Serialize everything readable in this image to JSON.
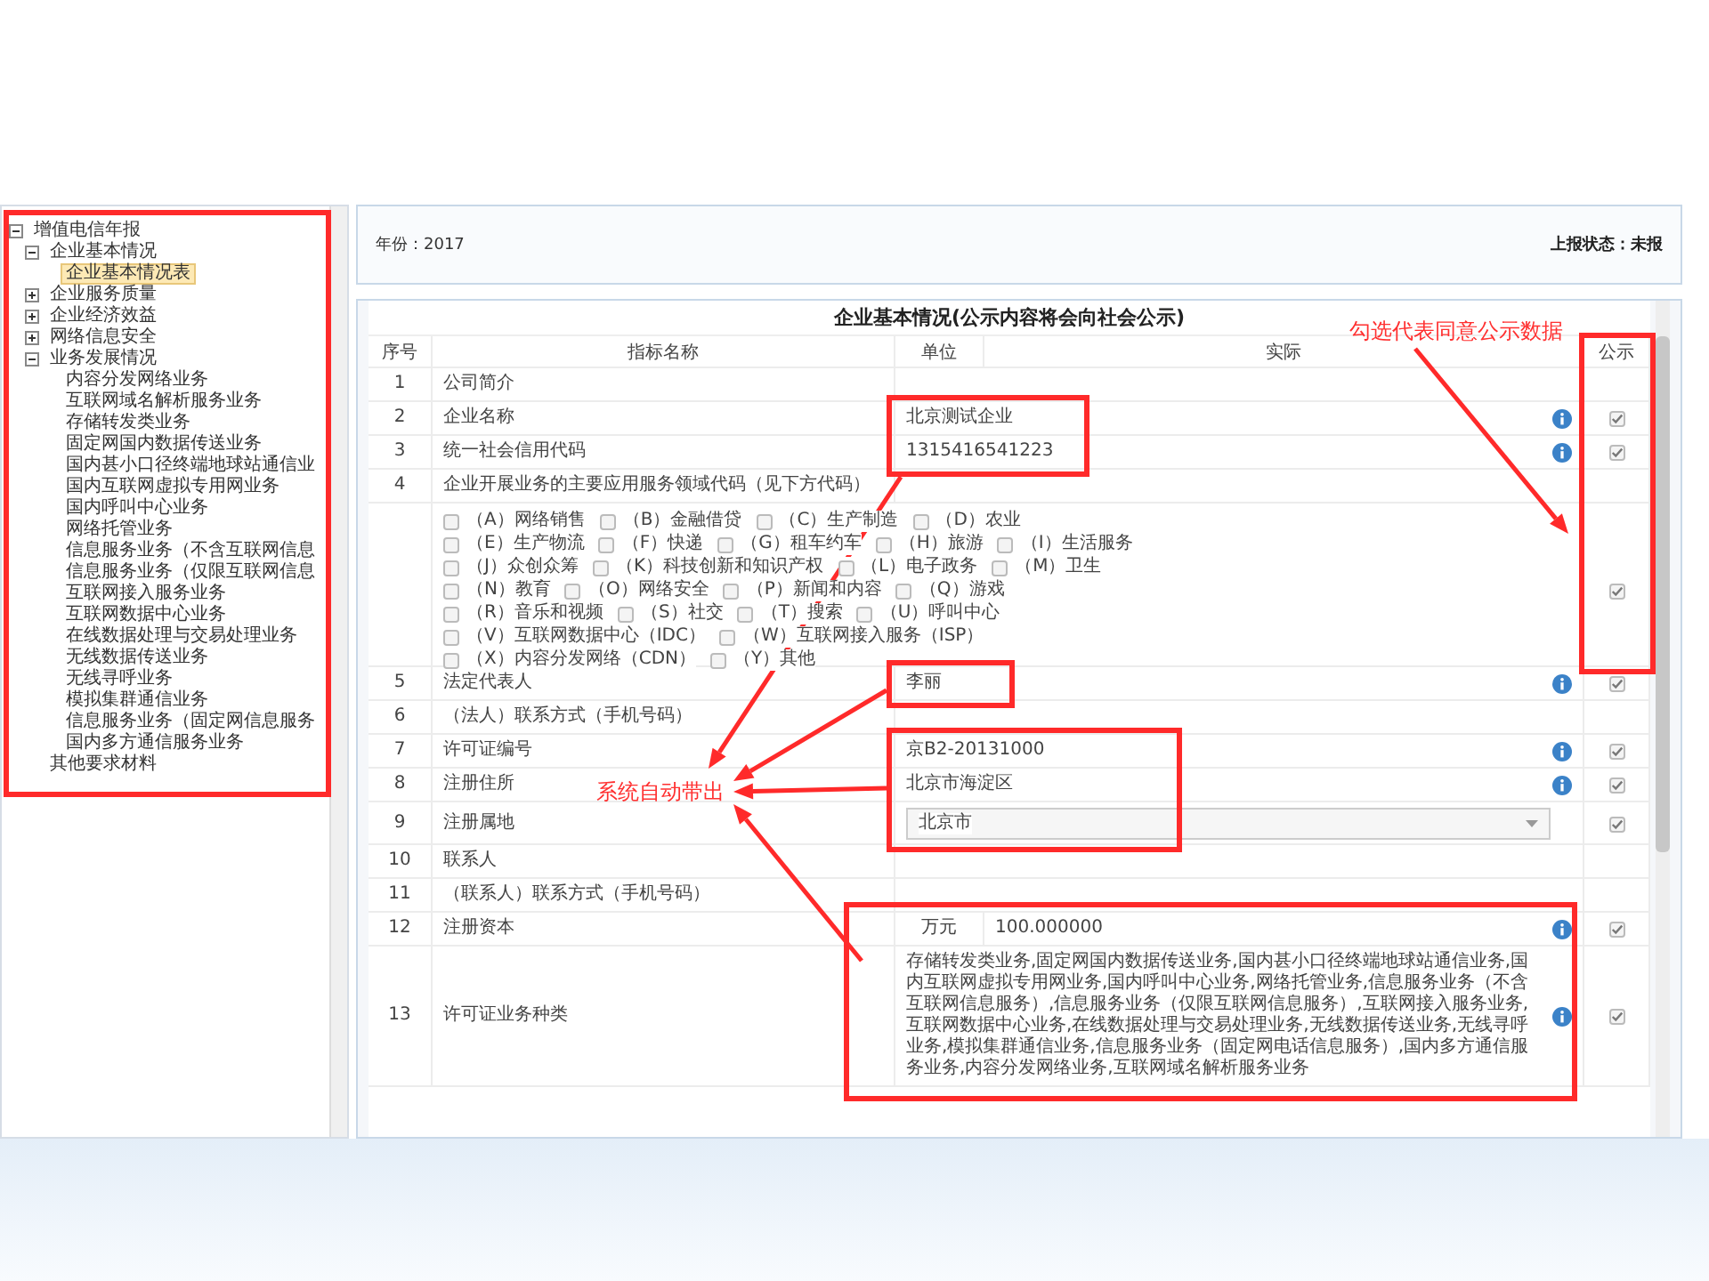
{
  "tree": [
    {
      "label": "增值电信年报",
      "expanded": true,
      "selected": false,
      "children": [
        {
          "label": "企业基本情况",
          "expanded": true,
          "selected": false,
          "children": [
            {
              "label": "企业基本情况表",
              "selected": true
            }
          ]
        },
        {
          "label": "企业服务质量",
          "expanded": false,
          "selected": false
        },
        {
          "label": "企业经济效益",
          "expanded": false,
          "selected": false
        },
        {
          "label": "网络信息安全",
          "expanded": false,
          "selected": false
        },
        {
          "label": "业务发展情况",
          "expanded": true,
          "selected": false,
          "children": [
            {
              "label": "内容分发网络业务",
              "selected": false
            },
            {
              "label": "互联网域名解析服务业务",
              "selected": false
            },
            {
              "label": "存储转发类业务",
              "selected": false
            },
            {
              "label": "固定网国内数据传送业务",
              "selected": false
            },
            {
              "label": "国内甚小口径终端地球站通信业",
              "selected": false
            },
            {
              "label": "国内互联网虚拟专用网业务",
              "selected": false
            },
            {
              "label": "国内呼叫中心业务",
              "selected": false
            },
            {
              "label": "网络托管业务",
              "selected": false
            },
            {
              "label": "信息服务业务（不含互联网信息",
              "selected": false
            },
            {
              "label": "信息服务业务（仅限互联网信息",
              "selected": false
            },
            {
              "label": "互联网接入服务业务",
              "selected": false
            },
            {
              "label": "互联网数据中心业务",
              "selected": false
            },
            {
              "label": "在线数据处理与交易处理业务",
              "selected": false
            },
            {
              "label": "无线数据传送业务",
              "selected": false
            },
            {
              "label": "无线寻呼业务",
              "selected": false
            },
            {
              "label": "模拟集群通信业务",
              "selected": false
            },
            {
              "label": "信息服务业务（固定网信息服务",
              "selected": false
            },
            {
              "label": "国内多方通信服务业务",
              "selected": false
            }
          ]
        },
        {
          "label": "其他要求材料",
          "selected": false
        }
      ]
    }
  ],
  "header": {
    "year": "年份：2017",
    "status": "上报状态：未报"
  },
  "table": {
    "title": "企业基本情况(公示内容将会向社会公示)",
    "columns": [
      "序号",
      "指标名称",
      "单位",
      "实际",
      "公示"
    ],
    "rows": [
      {
        "kind": "text",
        "no": "1",
        "name": "公司简介"
      },
      {
        "kind": "text",
        "no": "2",
        "name": "企业名称",
        "value": "北京测试企业",
        "info": true,
        "public": true
      },
      {
        "kind": "text",
        "no": "3",
        "name": "统一社会信用代码",
        "value": "1315416541223",
        "info": true,
        "public": true
      },
      {
        "kind": "text",
        "no": "4",
        "name": "企业开展业务的主要应用服务领域代码（见下方代码）"
      },
      {
        "kind": "options",
        "public": true,
        "lines": [
          [
            {
              "label": "（A）网络销售",
              "checked": false
            },
            {
              "label": "（B）金融借贷",
              "checked": false
            },
            {
              "label": "（C）生产制造",
              "checked": false
            },
            {
              "label": "（D）农业",
              "checked": false
            }
          ],
          [
            {
              "label": "（E）生产物流",
              "checked": false
            },
            {
              "label": "（F）快递",
              "checked": false
            },
            {
              "label": "（G）租车约车",
              "checked": false
            },
            {
              "label": "（H）旅游",
              "checked": false
            },
            {
              "label": "（I）生活服务",
              "checked": false
            }
          ],
          [
            {
              "label": "（J）众创众筹",
              "checked": false
            },
            {
              "label": "（K）科技创新和知识产权",
              "checked": false
            },
            {
              "label": "（L）电子政务",
              "checked": false
            },
            {
              "label": "（M）卫生",
              "checked": false
            }
          ],
          [
            {
              "label": "（N）教育",
              "checked": false
            },
            {
              "label": "（O）网络安全",
              "checked": false
            },
            {
              "label": "（P）新闻和内容",
              "checked": false
            },
            {
              "label": "（Q）游戏",
              "checked": false
            }
          ],
          [
            {
              "label": "（R）音乐和视频",
              "checked": false
            },
            {
              "label": "（S）社交",
              "checked": false
            },
            {
              "label": "（T）搜索",
              "checked": false
            },
            {
              "label": "（U）呼叫中心",
              "checked": false
            }
          ],
          [
            {
              "label": "（V）互联网数据中心（IDC）",
              "checked": false
            },
            {
              "label": "（W）互联网接入服务（ISP）",
              "checked": false
            }
          ],
          [
            {
              "label": "（X）内容分发网络（CDN）",
              "checked": false
            },
            {
              "label": "（Y）其他",
              "checked": false
            }
          ]
        ]
      },
      {
        "kind": "text",
        "no": "5",
        "name": "法定代表人",
        "value": "李丽",
        "info": true,
        "public": true
      },
      {
        "kind": "text",
        "no": "6",
        "name": "（法人）联系方式（手机号码）"
      },
      {
        "kind": "text",
        "no": "7",
        "name": "许可证编号",
        "value": "京B2-20131000",
        "info": true,
        "public": true
      },
      {
        "kind": "text",
        "no": "8",
        "name": "注册住所",
        "value": "北京市海淀区",
        "info": true,
        "public": true
      },
      {
        "kind": "select",
        "no": "9",
        "name": "注册属地",
        "value": "北京市",
        "public": true
      },
      {
        "kind": "text",
        "no": "10",
        "name": "联系人"
      },
      {
        "kind": "text",
        "no": "11",
        "name": "（联系人）联系方式（手机号码）"
      },
      {
        "kind": "unit",
        "no": "12",
        "name": "注册资本",
        "unit": "万元",
        "value": "100.000000",
        "info": true,
        "public": true
      },
      {
        "kind": "text",
        "no": "13",
        "name": "许可证业务种类",
        "value": "存储转发类业务,固定网国内数据传送业务,国内甚小口径终端地球站通信业务,国内互联网虚拟专用网业务,国内呼叫中心业务,网络托管业务,信息服务业务（不含互联网信息服务）,信息服务业务（仅限互联网信息服务）,互联网接入服务业务,互联网数据中心业务,在线数据处理与交易处理业务,无线数据传送业务,无线寻呼业务,模拟集群通信业务,信息服务业务（固定网电话信息服务）,国内多方通信服务业务,内容分发网络业务,互联网域名解析服务业务",
        "info": true,
        "public": true
      }
    ]
  },
  "notes": [
    "勾选代表同意公示数据",
    "系统自动带出"
  ]
}
